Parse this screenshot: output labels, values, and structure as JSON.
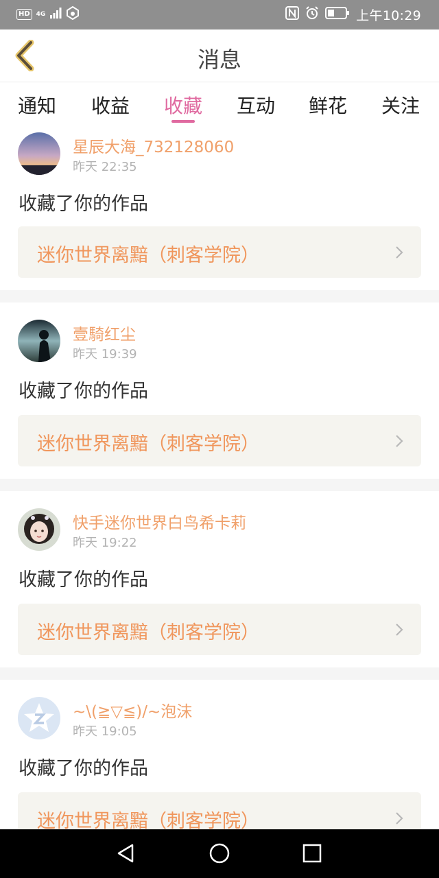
{
  "status_bar": {
    "hd_badge": "HD",
    "network_type": "4G",
    "time": "上午10:29",
    "icons": [
      "signal-icon",
      "wifi-hotspot-icon",
      "nfc-icon",
      "alarm-icon",
      "battery-icon"
    ]
  },
  "header": {
    "title": "消息",
    "back_icon": "chevron-left-icon"
  },
  "tabs": [
    {
      "label": "通知",
      "active": false
    },
    {
      "label": "收益",
      "active": false
    },
    {
      "label": "收藏",
      "active": true
    },
    {
      "label": "互动",
      "active": false
    },
    {
      "label": "鲜花",
      "active": false
    },
    {
      "label": "关注",
      "active": false
    }
  ],
  "messages": [
    {
      "username": "星辰大海_732128060",
      "time": "昨天 22:35",
      "action": "收藏了你的作品",
      "work_title": "迷你世界离黯（刺客学院）",
      "avatar": "sunset-sky-avatar"
    },
    {
      "username": "壹騎红尘",
      "time": "昨天 19:39",
      "action": "收藏了你的作品",
      "work_title": "迷你世界离黯（刺客学院）",
      "avatar": "silhouette-avatar"
    },
    {
      "username": "快手迷你世界白鸟希卡莉",
      "time": "昨天 19:22",
      "action": "收藏了你的作品",
      "work_title": "迷你世界离黯（刺客学院）",
      "avatar": "anime-girl-avatar"
    },
    {
      "username": "~\\(≧▽≦)/~泡沫",
      "time": "昨天 19:05",
      "action": "收藏了你的作品",
      "work_title": "迷你世界离黯（刺客学院）",
      "avatar": "qzone-star-avatar"
    }
  ],
  "nav_bar": {
    "buttons": [
      "back-triangle-icon",
      "home-circle-icon",
      "recents-square-icon"
    ]
  },
  "colors": {
    "accent": "#e06aa0",
    "username": "#f0a06a",
    "work_title": "#f0965c",
    "status_bar": "#8f8f8f",
    "card_link_bg": "#f5f4ef"
  }
}
